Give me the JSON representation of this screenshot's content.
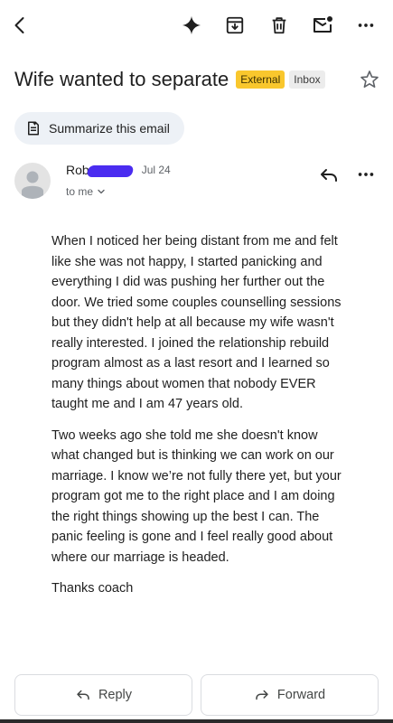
{
  "toolbar": {
    "back_icon": "back-arrow-icon",
    "actions": [
      "gemini-sparkle-icon",
      "archive-icon",
      "delete-icon",
      "mark-unread-icon",
      "more-vert-icon"
    ]
  },
  "email": {
    "subject": "Wife wanted to separate",
    "labels": {
      "external": "External",
      "inbox": "Inbox"
    },
    "summarize_label": "Summarize this email",
    "sender": {
      "name": "Rob",
      "date": "Jul 24",
      "recipient": "to me"
    },
    "body": [
      "When I noticed her being distant from me and felt like she was not happy, I started panicking and everything I did was pushing her further out the door. We tried some couples counselling sessions but they didn't help at all because my wife wasn't really interested. I joined the relationship rebuild program almost as a last resort and I learned so many things about women that nobody EVER taught me and I am 47 years old.",
      "Two weeks ago she told me she doesn't know what changed but is thinking we can work on our marriage. I know we’re not fully there yet, but your program got me to the right place and I am doing the right things showing up the best I can. The panic feeling is gone and I feel really good about where our marriage is headed.",
      "Thanks coach"
    ]
  },
  "actions": {
    "reply_label": "Reply",
    "forward_label": "Forward"
  },
  "colors": {
    "external_label": "#f9c72d",
    "inbox_label": "#ececec",
    "summarize_bg": "#edf1f6",
    "redaction": "#4a2cf0"
  }
}
